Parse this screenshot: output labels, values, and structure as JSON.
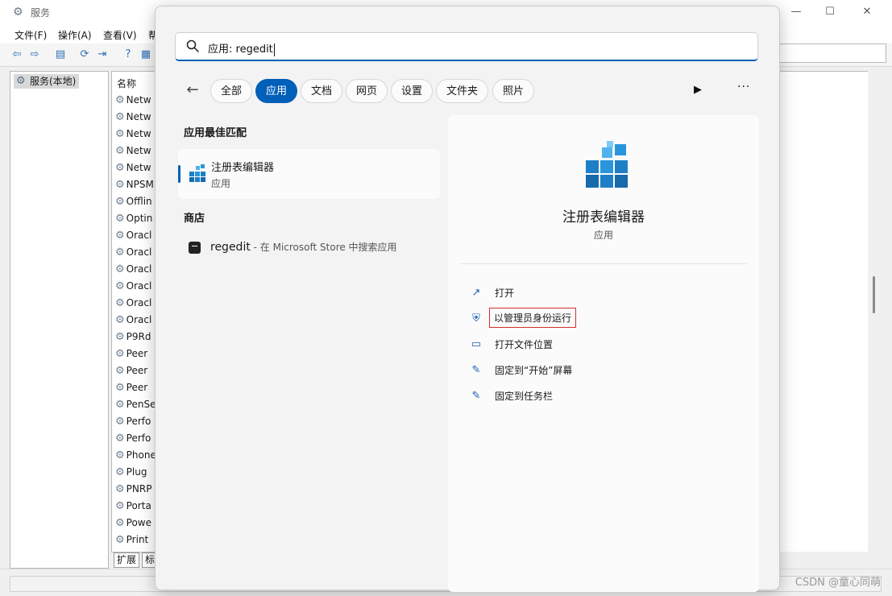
{
  "services_window": {
    "title": "服务",
    "menu": [
      "文件(F)",
      "操作(A)",
      "查看(V)",
      "帮"
    ],
    "tree_item": "服务(本地)",
    "list_header": "名称",
    "rows": [
      "Netw",
      "Netw",
      "Netw",
      "Netw",
      "Netw",
      "NPSM",
      "Offlin",
      "Optin",
      "Oracl",
      "Oracl",
      "Oracl",
      "Oracl",
      "Oracl",
      "Oracl",
      "P9Rd",
      "Peer",
      "Peer",
      "Peer",
      "PenSe",
      "Perfo",
      "Perfo",
      "Phone",
      "Plug",
      "PNRP",
      "Porta",
      "Powe",
      "Print"
    ],
    "tabs": [
      "扩展",
      "标"
    ]
  },
  "search": {
    "query": "应用: regedit",
    "filters": [
      "全部",
      "应用",
      "文档",
      "网页",
      "设置",
      "文件夹",
      "照片"
    ],
    "active_filter": "应用"
  },
  "results": {
    "best_match_title": "应用最佳匹配",
    "best_match": {
      "name": "注册表编辑器",
      "type": "应用"
    },
    "store_title": "商店",
    "store_item": {
      "name": "regedit",
      "desc": " - 在 Microsoft Store 中搜索应用"
    }
  },
  "detail": {
    "name": "注册表编辑器",
    "type": "应用",
    "actions": [
      {
        "label": "打开",
        "icon": "open-external-icon"
      },
      {
        "label": "以管理员身份运行",
        "icon": "shield-icon",
        "highlighted": true
      },
      {
        "label": "打开文件位置",
        "icon": "folder-icon"
      },
      {
        "label": "固定到“开始”屏幕",
        "icon": "pin-icon"
      },
      {
        "label": "固定到任务栏",
        "icon": "pin-icon"
      }
    ]
  },
  "watermark": "CSDN @童心同萌",
  "colors": {
    "accent": "#005fb8",
    "highlight_box": "#d32f2f"
  }
}
